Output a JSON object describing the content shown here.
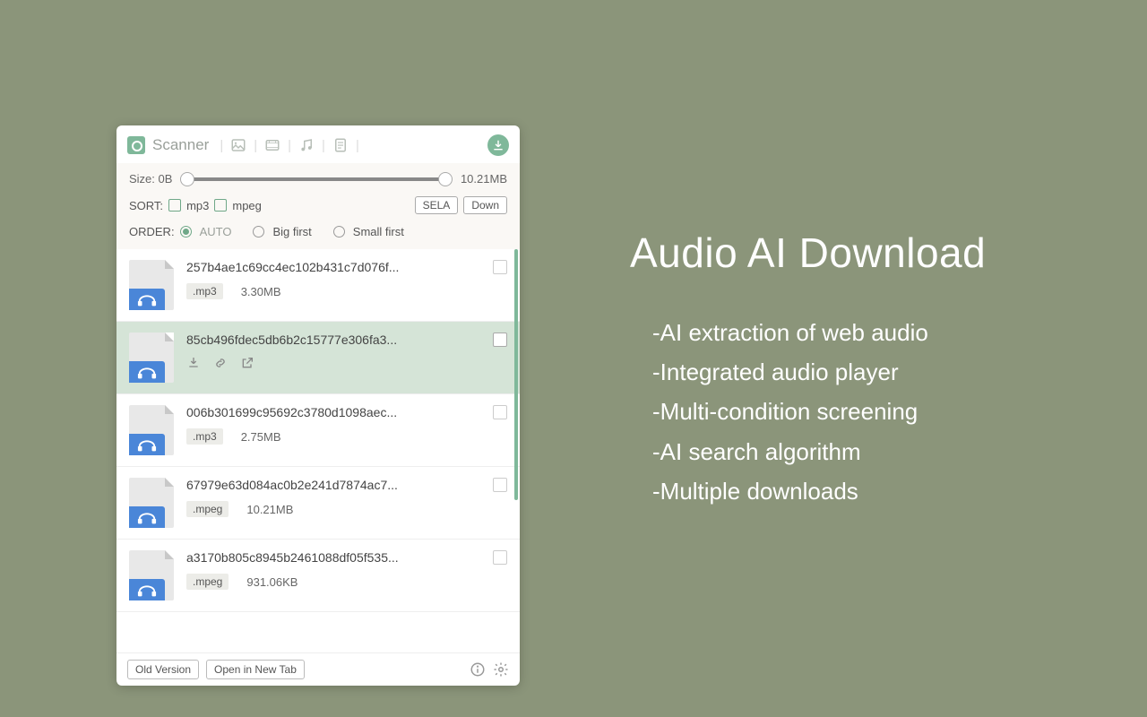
{
  "header": {
    "title": "Scanner"
  },
  "filters": {
    "size_label": "Size: 0B",
    "size_max": "10.21MB",
    "sort_label": "SORT:",
    "sort_opts": [
      "mp3",
      "mpeg"
    ],
    "sela_btn": "SELA",
    "down_btn": "Down",
    "order_label": "ORDER:",
    "order_auto": "AUTO",
    "order_big": "Big first",
    "order_small": "Small first"
  },
  "items": [
    {
      "name": "257b4ae1c69cc4ec102b431c7d076f...",
      "ext": ".mp3",
      "size": "3.30MB",
      "selected": false
    },
    {
      "name": "85cb496fdec5db6b2c15777e306fa3...",
      "ext": "",
      "size": "",
      "selected": true
    },
    {
      "name": "006b301699c95692c3780d1098aec...",
      "ext": ".mp3",
      "size": "2.75MB",
      "selected": false
    },
    {
      "name": "67979e63d084ac0b2e241d7874ac7...",
      "ext": ".mpeg",
      "size": "10.21MB",
      "selected": false
    },
    {
      "name": "a3170b805c8945b2461088df05f535...",
      "ext": ".mpeg",
      "size": "931.06KB",
      "selected": false
    }
  ],
  "footer": {
    "old_version": "Old Version",
    "open_tab": "Open in New Tab"
  },
  "promo": {
    "title": "Audio AI Download",
    "bullets": [
      "-AI extraction of web audio",
      "-Integrated audio player",
      "-Multi-condition screening",
      "-AI search algorithm",
      "-Multiple downloads"
    ]
  }
}
